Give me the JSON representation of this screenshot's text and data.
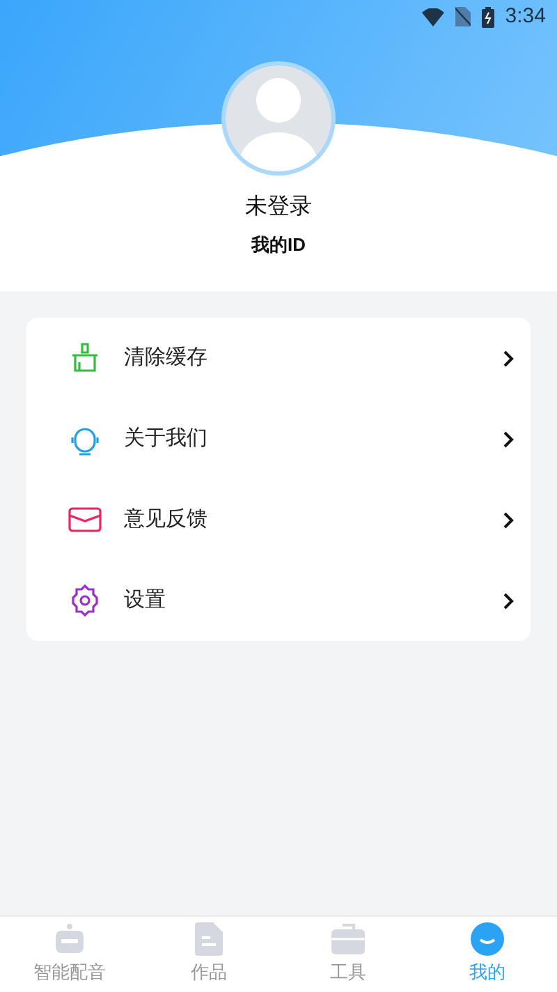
{
  "status_bar": {
    "time": "3:34"
  },
  "profile": {
    "name": "未登录",
    "id_label": "我的ID"
  },
  "menu": [
    {
      "kind": "clean",
      "label": "清除缓存"
    },
    {
      "kind": "about",
      "label": "关于我们"
    },
    {
      "kind": "feedback",
      "label": "意见反馈"
    },
    {
      "kind": "settings",
      "label": "设置"
    }
  ],
  "tabs": [
    {
      "kind": "dubbing",
      "label": "智能配音",
      "selected": false
    },
    {
      "kind": "works",
      "label": "作品",
      "selected": false
    },
    {
      "kind": "tools",
      "label": "工具",
      "selected": false
    },
    {
      "kind": "mine",
      "label": "我的",
      "selected": true
    }
  ]
}
